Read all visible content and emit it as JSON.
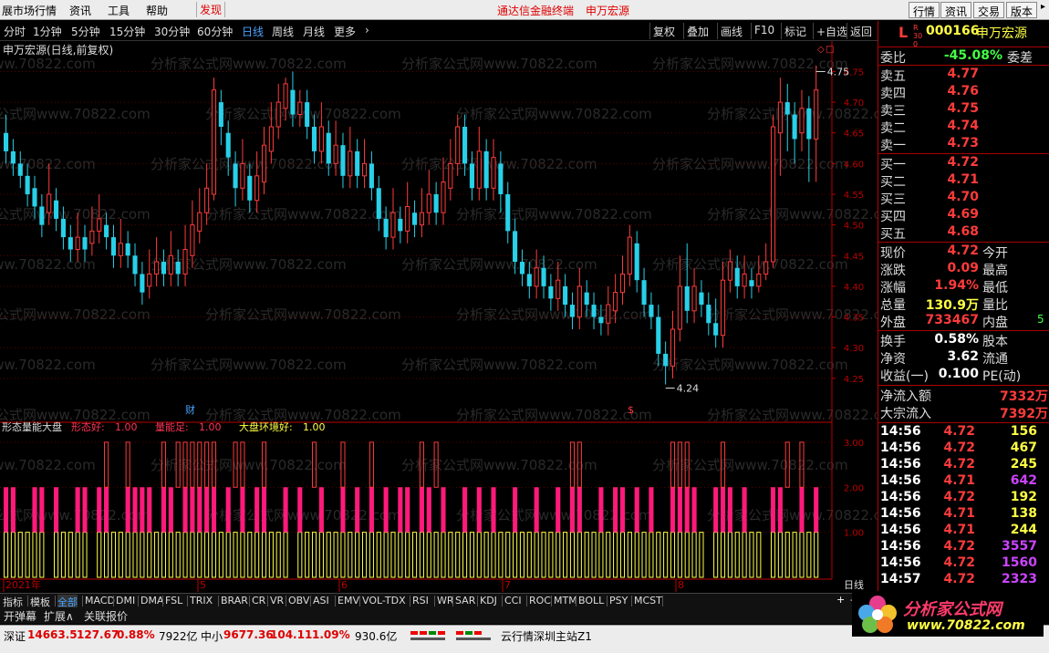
{
  "menu": {
    "app_title": "展市场行情",
    "items": [
      "资讯",
      "工具",
      "帮助"
    ],
    "discover": "发现",
    "center_title": "通达信金融终端",
    "stock": "申万宏源",
    "right_buttons": [
      "行情",
      "资讯",
      "交易",
      "版本"
    ]
  },
  "toolbar": {
    "periods": [
      "分时",
      "1分钟",
      "5分钟",
      "15分钟",
      "30分钟",
      "60分钟",
      "日线",
      "周线",
      "月线",
      "更多"
    ],
    "active": "日线",
    "buttons": [
      "复权",
      "叠加",
      "画线",
      "F10",
      "标记",
      "+自选",
      "返回"
    ]
  },
  "chart": {
    "title": "申万宏源(日线,前复权)",
    "high_label": "4.75",
    "low_label": "4.24",
    "price_ticks": [
      "4.75",
      "4.70",
      "4.65",
      "4.60",
      "4.55",
      "4.50",
      "4.45",
      "4.40",
      "4.35",
      "4.30",
      "4.25"
    ],
    "fin_marker": "财",
    "s_marker": "$",
    "indicator_name": "形态量能大盘",
    "ind_items": [
      {
        "name": "形态好:",
        "value": "1.00",
        "color": "#ff3355"
      },
      {
        "name": "量能足:",
        "value": "1.00",
        "color": "#ff3355"
      },
      {
        "name": "大盘环境好:",
        "value": "1.00",
        "color": "#ffff44"
      }
    ],
    "ind_ticks": [
      "3.00",
      "2.00",
      "1.00"
    ],
    "date_labels": [
      "2021年",
      "5",
      "6",
      "7",
      "8"
    ],
    "period_label": "日线",
    "watermark": "分析家公式网www.70822.com"
  },
  "chart_data": {
    "type": "candlestick",
    "ylim": [
      4.22,
      4.77
    ],
    "candles": [
      [
        4.65,
        4.62,
        4.68,
        4.6
      ],
      [
        4.62,
        4.6,
        4.64,
        4.58
      ],
      [
        4.6,
        4.58,
        4.62,
        4.56
      ],
      [
        4.58,
        4.55,
        4.6,
        4.53
      ],
      [
        4.56,
        4.53,
        4.58,
        4.51
      ],
      [
        4.53,
        4.5,
        4.55,
        4.48
      ],
      [
        4.52,
        4.55,
        4.6,
        4.5
      ],
      [
        4.54,
        4.51,
        4.56,
        4.49
      ],
      [
        4.51,
        4.48,
        4.53,
        4.46
      ],
      [
        4.48,
        4.46,
        4.5,
        4.44
      ],
      [
        4.46,
        4.48,
        4.52,
        4.44
      ],
      [
        4.48,
        4.46,
        4.5,
        4.44
      ],
      [
        4.47,
        4.49,
        4.53,
        4.45
      ],
      [
        4.49,
        4.51,
        4.55,
        4.47
      ],
      [
        4.5,
        4.48,
        4.52,
        4.46
      ],
      [
        4.48,
        4.45,
        4.5,
        4.43
      ],
      [
        4.45,
        4.47,
        4.51,
        4.43
      ],
      [
        4.47,
        4.45,
        4.49,
        4.43
      ],
      [
        4.45,
        4.42,
        4.47,
        4.4
      ],
      [
        4.42,
        4.39,
        4.44,
        4.37
      ],
      [
        4.4,
        4.42,
        4.46,
        4.38
      ],
      [
        4.42,
        4.44,
        4.48,
        4.4
      ],
      [
        4.44,
        4.42,
        4.46,
        4.4
      ],
      [
        4.42,
        4.45,
        4.49,
        4.4
      ],
      [
        4.44,
        4.42,
        4.46,
        4.4
      ],
      [
        4.42,
        4.46,
        4.5,
        4.4
      ],
      [
        4.45,
        4.5,
        4.54,
        4.43
      ],
      [
        4.49,
        4.52,
        4.56,
        4.47
      ],
      [
        4.52,
        4.56,
        4.6,
        4.5
      ],
      [
        4.55,
        4.72,
        4.74,
        4.54
      ],
      [
        4.7,
        4.66,
        4.72,
        4.63
      ],
      [
        4.65,
        4.61,
        4.67,
        4.58
      ],
      [
        4.6,
        4.56,
        4.62,
        4.53
      ],
      [
        4.56,
        4.6,
        4.64,
        4.54
      ],
      [
        4.58,
        4.54,
        4.6,
        4.52
      ],
      [
        4.54,
        4.58,
        4.62,
        4.52
      ],
      [
        4.57,
        4.63,
        4.66,
        4.55
      ],
      [
        4.62,
        4.66,
        4.7,
        4.6
      ],
      [
        4.66,
        4.7,
        4.73,
        4.64
      ],
      [
        4.69,
        4.73,
        4.74,
        4.67
      ],
      [
        4.72,
        4.68,
        4.75,
        4.66
      ],
      [
        4.68,
        4.7,
        4.72,
        4.66
      ],
      [
        4.7,
        4.66,
        4.72,
        4.64
      ],
      [
        4.66,
        4.62,
        4.68,
        4.6
      ],
      [
        4.62,
        4.66,
        4.7,
        4.6
      ],
      [
        4.65,
        4.6,
        4.67,
        4.58
      ],
      [
        4.6,
        4.63,
        4.67,
        4.58
      ],
      [
        4.63,
        4.58,
        4.65,
        4.56
      ],
      [
        4.58,
        4.62,
        4.66,
        4.56
      ],
      [
        4.62,
        4.58,
        4.64,
        4.56
      ],
      [
        4.58,
        4.6,
        4.64,
        4.56
      ],
      [
        4.6,
        4.56,
        4.62,
        4.54
      ],
      [
        4.56,
        4.51,
        4.58,
        4.49
      ],
      [
        4.51,
        4.48,
        4.53,
        4.46
      ],
      [
        4.48,
        4.52,
        4.56,
        4.46
      ],
      [
        4.51,
        4.49,
        4.53,
        4.47
      ],
      [
        4.49,
        4.53,
        4.57,
        4.47
      ],
      [
        4.52,
        4.5,
        4.54,
        4.48
      ],
      [
        4.5,
        4.52,
        4.56,
        4.48
      ],
      [
        4.52,
        4.55,
        4.59,
        4.5
      ],
      [
        4.55,
        4.52,
        4.57,
        4.5
      ],
      [
        4.52,
        4.57,
        4.61,
        4.5
      ],
      [
        4.56,
        4.6,
        4.64,
        4.54
      ],
      [
        4.6,
        4.66,
        4.68,
        4.58
      ],
      [
        4.66,
        4.6,
        4.68,
        4.58
      ],
      [
        4.6,
        4.56,
        4.62,
        4.54
      ],
      [
        4.56,
        4.62,
        4.66,
        4.54
      ],
      [
        4.62,
        4.56,
        4.64,
        4.54
      ],
      [
        4.56,
        4.61,
        4.64,
        4.54
      ],
      [
        4.6,
        4.55,
        4.62,
        4.52
      ],
      [
        4.55,
        4.49,
        4.57,
        4.47
      ],
      [
        4.49,
        4.44,
        4.51,
        4.42
      ],
      [
        4.44,
        4.42,
        4.46,
        4.4
      ],
      [
        4.42,
        4.4,
        4.44,
        4.38
      ],
      [
        4.4,
        4.43,
        4.46,
        4.38
      ],
      [
        4.43,
        4.4,
        4.45,
        4.38
      ],
      [
        4.4,
        4.38,
        4.42,
        4.36
      ],
      [
        4.38,
        4.41,
        4.44,
        4.36
      ],
      [
        4.4,
        4.37,
        4.42,
        4.35
      ],
      [
        4.37,
        4.35,
        4.39,
        4.33
      ],
      [
        4.35,
        4.4,
        4.43,
        4.33
      ],
      [
        4.39,
        4.37,
        4.41,
        4.35
      ],
      [
        4.37,
        4.35,
        4.39,
        4.33
      ],
      [
        4.35,
        4.34,
        4.37,
        4.32
      ],
      [
        4.34,
        4.37,
        4.4,
        4.32
      ],
      [
        4.36,
        4.39,
        4.42,
        4.34
      ],
      [
        4.39,
        4.42,
        4.45,
        4.37
      ],
      [
        4.42,
        4.48,
        4.5,
        4.4
      ],
      [
        4.47,
        4.41,
        4.49,
        4.39
      ],
      [
        4.41,
        4.37,
        4.43,
        4.35
      ],
      [
        4.37,
        4.35,
        4.39,
        4.33
      ],
      [
        4.35,
        4.29,
        4.37,
        4.27
      ],
      [
        4.29,
        4.27,
        4.31,
        4.24
      ],
      [
        4.27,
        4.33,
        4.36,
        4.25
      ],
      [
        4.33,
        4.4,
        4.45,
        4.31
      ],
      [
        4.4,
        4.36,
        4.47,
        4.34
      ],
      [
        4.36,
        4.4,
        4.43,
        4.34
      ],
      [
        4.39,
        4.37,
        4.41,
        4.35
      ],
      [
        4.37,
        4.34,
        4.39,
        4.32
      ],
      [
        4.34,
        4.32,
        4.38,
        4.3
      ],
      [
        4.32,
        4.41,
        4.44,
        4.3
      ],
      [
        4.41,
        4.44,
        4.46,
        4.39
      ],
      [
        4.43,
        4.4,
        4.45,
        4.38
      ],
      [
        4.4,
        4.42,
        4.45,
        4.38
      ],
      [
        4.41,
        4.4,
        4.43,
        4.38
      ],
      [
        4.4,
        4.42,
        4.45,
        4.39
      ],
      [
        4.42,
        4.44,
        4.47,
        4.41
      ],
      [
        4.44,
        4.66,
        4.68,
        4.43
      ],
      [
        4.65,
        4.7,
        4.74,
        4.58
      ],
      [
        4.7,
        4.68,
        4.73,
        4.62
      ],
      [
        4.68,
        4.64,
        4.7,
        4.6
      ],
      [
        4.65,
        4.69,
        4.72,
        4.62
      ],
      [
        4.69,
        4.64,
        4.71,
        4.57
      ],
      [
        4.64,
        4.72,
        4.76,
        4.57
      ]
    ],
    "vol_ind": [
      [
        1,
        1,
        0
      ],
      [
        1,
        1,
        0
      ],
      [
        1,
        0,
        0
      ],
      [
        1,
        0,
        0
      ],
      [
        1,
        1,
        0
      ],
      [
        1,
        1,
        0
      ],
      [
        0,
        0,
        0
      ],
      [
        1,
        1,
        0
      ],
      [
        1,
        0,
        0
      ],
      [
        1,
        0,
        0
      ],
      [
        1,
        1,
        0
      ],
      [
        1,
        1,
        0
      ],
      [
        0,
        0,
        0
      ],
      [
        1,
        1,
        0
      ],
      [
        1,
        1,
        1
      ],
      [
        1,
        0,
        0
      ],
      [
        1,
        0,
        0
      ],
      [
        1,
        1,
        1
      ],
      [
        1,
        1,
        0
      ],
      [
        1,
        1,
        0
      ],
      [
        1,
        1,
        0
      ],
      [
        1,
        0,
        0
      ],
      [
        1,
        1,
        1
      ],
      [
        1,
        1,
        0
      ],
      [
        1,
        0,
        1
      ],
      [
        1,
        1,
        1
      ],
      [
        1,
        1,
        1
      ],
      [
        1,
        1,
        1
      ],
      [
        1,
        1,
        1
      ],
      [
        1,
        1,
        1
      ],
      [
        1,
        0,
        0
      ],
      [
        1,
        1,
        0
      ],
      [
        1,
        0,
        1
      ],
      [
        1,
        1,
        1
      ],
      [
        1,
        0,
        0
      ],
      [
        1,
        1,
        0
      ],
      [
        1,
        1,
        1
      ],
      [
        1,
        0,
        0
      ],
      [
        1,
        0,
        0
      ],
      [
        1,
        1,
        0
      ],
      [
        0,
        0,
        0
      ],
      [
        1,
        1,
        0
      ],
      [
        1,
        0,
        0
      ],
      [
        1,
        0,
        1
      ],
      [
        1,
        1,
        0
      ],
      [
        1,
        0,
        0
      ],
      [
        1,
        0,
        0
      ],
      [
        1,
        1,
        1
      ],
      [
        1,
        0,
        0
      ],
      [
        1,
        1,
        0
      ],
      [
        1,
        0,
        0
      ],
      [
        1,
        1,
        1
      ],
      [
        1,
        0,
        0
      ],
      [
        1,
        1,
        0
      ],
      [
        1,
        0,
        0
      ],
      [
        1,
        1,
        0
      ],
      [
        1,
        1,
        0
      ],
      [
        1,
        0,
        0
      ],
      [
        1,
        1,
        1
      ],
      [
        1,
        1,
        0
      ],
      [
        1,
        0,
        1
      ],
      [
        1,
        1,
        0
      ],
      [
        1,
        0,
        0
      ],
      [
        1,
        0,
        0
      ],
      [
        1,
        1,
        0
      ],
      [
        1,
        0,
        0
      ],
      [
        1,
        1,
        0
      ],
      [
        1,
        0,
        0
      ],
      [
        1,
        1,
        0
      ],
      [
        1,
        0,
        0
      ],
      [
        1,
        0,
        0
      ],
      [
        1,
        1,
        0
      ],
      [
        1,
        0,
        0
      ],
      [
        1,
        0,
        0
      ],
      [
        1,
        1,
        0
      ],
      [
        1,
        0,
        0
      ],
      [
        1,
        0,
        0
      ],
      [
        1,
        1,
        0
      ],
      [
        1,
        0,
        0
      ],
      [
        1,
        1,
        1
      ],
      [
        1,
        1,
        1
      ],
      [
        1,
        0,
        0
      ],
      [
        1,
        0,
        0
      ],
      [
        1,
        1,
        0
      ],
      [
        1,
        0,
        0
      ],
      [
        1,
        1,
        0
      ],
      [
        1,
        1,
        0
      ],
      [
        1,
        0,
        0
      ],
      [
        1,
        1,
        0
      ],
      [
        1,
        0,
        0
      ],
      [
        1,
        1,
        0
      ],
      [
        1,
        0,
        0
      ],
      [
        1,
        0,
        0
      ],
      [
        1,
        1,
        1
      ],
      [
        1,
        1,
        1
      ],
      [
        1,
        1,
        1
      ],
      [
        1,
        1,
        0
      ],
      [
        1,
        0,
        0
      ],
      [
        0,
        0,
        0
      ],
      [
        1,
        1,
        0
      ],
      [
        1,
        1,
        1
      ],
      [
        1,
        1,
        0
      ],
      [
        1,
        0,
        0
      ],
      [
        1,
        1,
        0
      ],
      [
        1,
        0,
        0
      ],
      [
        1,
        0,
        0
      ],
      [
        0,
        0,
        0
      ],
      [
        1,
        1,
        0
      ],
      [
        1,
        1,
        0
      ],
      [
        1,
        0,
        1
      ],
      [
        1,
        0,
        0
      ],
      [
        1,
        1,
        1
      ],
      [
        1,
        0,
        0
      ],
      [
        1,
        1,
        0
      ]
    ]
  },
  "quote": {
    "tag": "L",
    "tag_sub": "R 300",
    "code": "000166",
    "name": "申万宏源",
    "webi_label": "委比",
    "webi_value": "-45.08%",
    "weicha_label": "委差",
    "asks": [
      {
        "label": "卖五",
        "price": "4.77"
      },
      {
        "label": "卖四",
        "price": "4.76"
      },
      {
        "label": "卖三",
        "price": "4.75"
      },
      {
        "label": "卖二",
        "price": "4.74"
      },
      {
        "label": "卖一",
        "price": "4.73"
      }
    ],
    "bids": [
      {
        "label": "买一",
        "price": "4.72"
      },
      {
        "label": "买二",
        "price": "4.71"
      },
      {
        "label": "买三",
        "price": "4.70"
      },
      {
        "label": "买四",
        "price": "4.69"
      },
      {
        "label": "买五",
        "price": "4.68"
      }
    ],
    "stats": [
      {
        "l": "现价",
        "v": "4.72",
        "r": "今开",
        "c": "#ff3b3b"
      },
      {
        "l": "涨跌",
        "v": "0.09",
        "r": "最高",
        "c": "#ff3b3b"
      },
      {
        "l": "涨幅",
        "v": "1.94%",
        "r": "最低",
        "c": "#ff3b3b"
      },
      {
        "l": "总量",
        "v": "130.9万",
        "r": "量比",
        "c": "#ffff44"
      },
      {
        "l": "外盘",
        "v": "733467",
        "r": "内盘",
        "c": "#ff3b3b"
      }
    ],
    "stats2": [
      {
        "l": "换手",
        "v": "0.58%",
        "r": "股本"
      },
      {
        "l": "净资",
        "v": "3.62",
        "r": "流通"
      },
      {
        "l": "收益(一)",
        "v": "0.100",
        "r": "PE(动)"
      }
    ],
    "flow": [
      {
        "l": "净流入额",
        "v": "7332万"
      },
      {
        "l": "大宗流入",
        "v": "7392万"
      }
    ],
    "ticks": [
      [
        "14:56",
        "4.72",
        "156",
        "#ffff44"
      ],
      [
        "14:56",
        "4.72",
        "467",
        "#ffff44"
      ],
      [
        "14:56",
        "4.72",
        "245",
        "#ffff44"
      ],
      [
        "14:56",
        "4.71",
        "642",
        "#cc44ff"
      ],
      [
        "14:56",
        "4.72",
        "192",
        "#ffff44"
      ],
      [
        "14:56",
        "4.71",
        "138",
        "#ffff44"
      ],
      [
        "14:56",
        "4.71",
        "244",
        "#ffff44"
      ],
      [
        "14:56",
        "4.72",
        "3557",
        "#cc44ff"
      ],
      [
        "14:56",
        "4.72",
        "1560",
        "#cc44ff"
      ],
      [
        "14:57",
        "4.72",
        "2323",
        "#cc44ff"
      ]
    ],
    "side_mark": "5"
  },
  "bottom_tabs": [
    "指标",
    "模板",
    "全部",
    "MACD",
    "DMI",
    "DMA",
    "FSL",
    "TRIX",
    "BRAR",
    "CR",
    "VR",
    "OBV",
    "ASI",
    "EMV",
    "VOL-TDX",
    "RSI",
    "WR",
    "SAR",
    "KDJ",
    "CCI",
    "ROC",
    "MTM",
    "BOLL",
    "PSY",
    "MCST"
  ],
  "bottom_tabs2": [
    "开弹幕",
    "扩展∧",
    "关联报价"
  ],
  "status": {
    "sz_label": "深证",
    "sz_value": "14663.5",
    "sz_chg": "127.67",
    "sz_pct": "0.88%",
    "sz_amt": "7922亿",
    "zx_label": "中小",
    "zx_value": "9677.36",
    "zx_chg": "104.11",
    "zx_pct": "1.09%",
    "zx_amt": "930.6亿",
    "server": "云行情深圳主站Z1"
  },
  "logo": {
    "name": "分析家公式网",
    "url": "www.70822.com"
  }
}
